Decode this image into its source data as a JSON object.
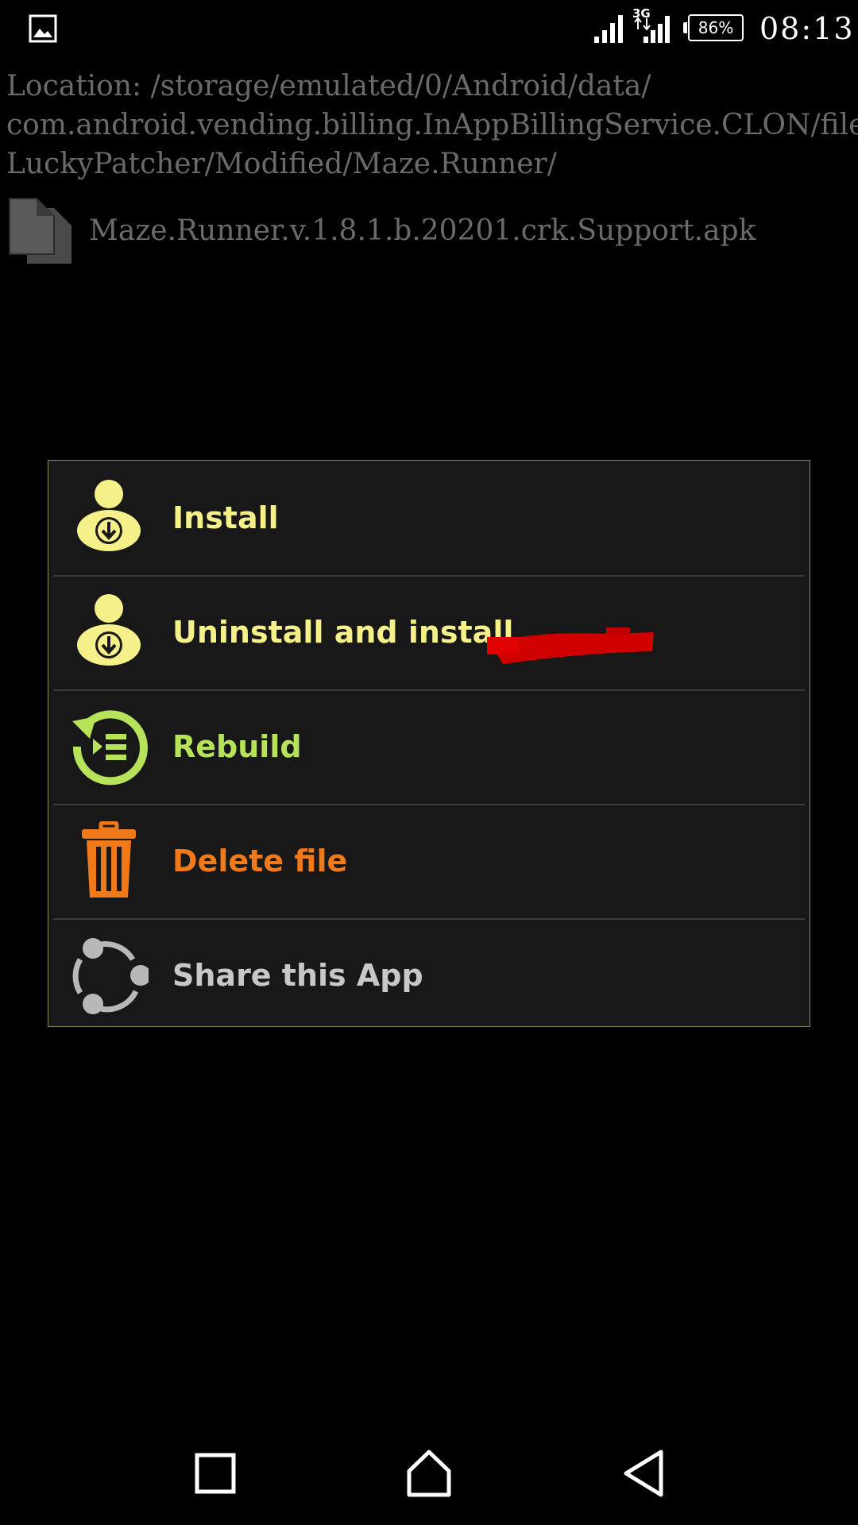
{
  "status_bar": {
    "battery": "86%",
    "time": "08:13",
    "icons": [
      "gallery-icon",
      "signal-icon",
      "3g-signal-icon",
      "battery-icon"
    ]
  },
  "location_text": "Location: /storage/emulated/0/Android/data/\ncom.android.vending.billing.InAppBillingService.CLON/files/\nLuckyPatcher/Modified/Maze.Runner/",
  "file": {
    "name": "Maze.Runner.v.1.8.1.b.20201.crk.Support.apk",
    "icon": "file-copy-icon"
  },
  "menu": [
    {
      "label": "Install",
      "color": "#f5f08a",
      "icon": "install-user-icon"
    },
    {
      "label": "Uninstall and install",
      "color": "#f5f08a",
      "icon": "install-user-icon"
    },
    {
      "label": "Rebuild",
      "color": "#b6e35a",
      "icon": "rebuild-icon"
    },
    {
      "label": "Delete file",
      "color": "#f07a1a",
      "icon": "trash-icon"
    },
    {
      "label": "Share this App",
      "color": "#c8c8c8",
      "icon": "share-icon"
    }
  ],
  "nav": [
    "recents-button",
    "home-button",
    "back-button"
  ]
}
